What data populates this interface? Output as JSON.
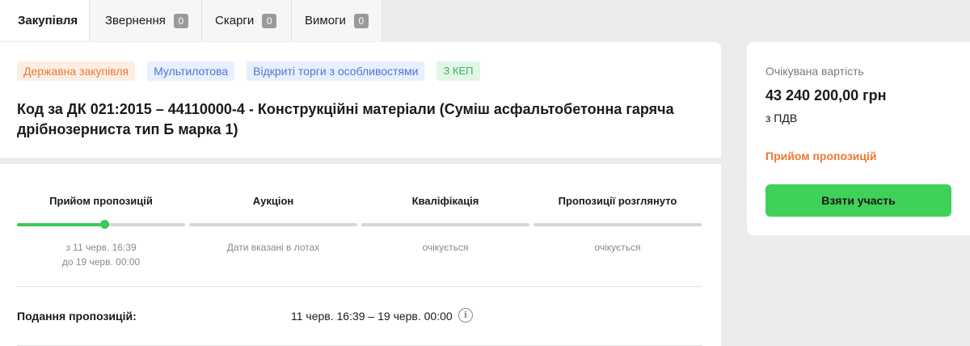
{
  "tabs": [
    {
      "label": "Закупівля",
      "badge": null,
      "active": true
    },
    {
      "label": "Звернення",
      "badge": "0"
    },
    {
      "label": "Скарги",
      "badge": "0"
    },
    {
      "label": "Вимоги",
      "badge": "0"
    }
  ],
  "tags": {
    "procurement_type": "Державна закупівля",
    "lots": "Мультилотова",
    "procedure": "Відкриті торги з особливостями",
    "signature": "З КЕП"
  },
  "title": "Код за ДК 021:2015 – 44110000-4 - Конструкційні матеріали (Суміш асфальтобетонна гаряча дрібнозерниста тип Б марка 1)",
  "stages": [
    {
      "label": "Прийом пропозицій",
      "sub1": "з 11 черв. 16:39",
      "sub2": "до 19 черв. 00:00",
      "progress": 0.52
    },
    {
      "label": "Аукціон",
      "sub1": "Дати вказані в лотах",
      "sub2": "",
      "progress": 0
    },
    {
      "label": "Кваліфікація",
      "sub1": "очікується",
      "sub2": "",
      "progress": 0
    },
    {
      "label": "Пропозиції розглянуто",
      "sub1": "очікується",
      "sub2": "",
      "progress": 0
    }
  ],
  "submission": {
    "label": "Подання пропозицій:",
    "value": "11 черв. 16:39 – 19 черв. 00:00",
    "info_icon": "i"
  },
  "side": {
    "expected_label": "Очікувана вартість",
    "amount": "43 240 200,00 грн",
    "vat": "з ПДВ",
    "status": "Прийом пропозицій",
    "button": "Взяти участь"
  },
  "colors": {
    "accent_green": "#3fd158",
    "status_orange": "#f07833"
  }
}
